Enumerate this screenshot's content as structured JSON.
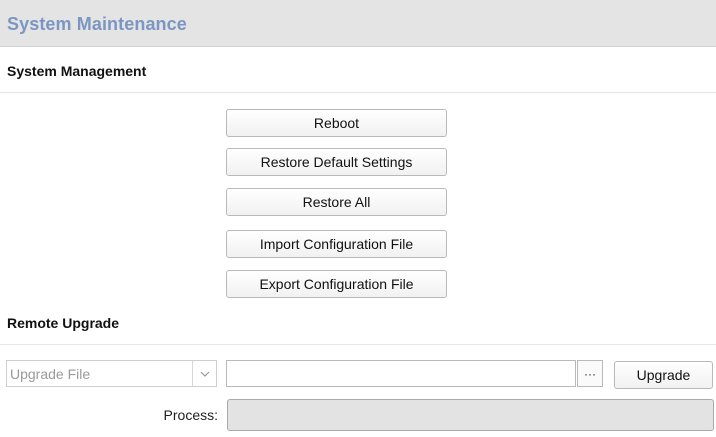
{
  "header": {
    "title": "System Maintenance"
  },
  "system_management": {
    "title": "System Management",
    "buttons": [
      "Reboot",
      "Restore Default Settings",
      "Restore All",
      "Import Configuration File",
      "Export Configuration File"
    ]
  },
  "remote_upgrade": {
    "title": "Remote Upgrade",
    "upgrade_type": "Upgrade File",
    "file_path": "",
    "browse_label": "···",
    "upgrade_label": "Upgrade",
    "process_label": "Process:",
    "progress": 0
  }
}
